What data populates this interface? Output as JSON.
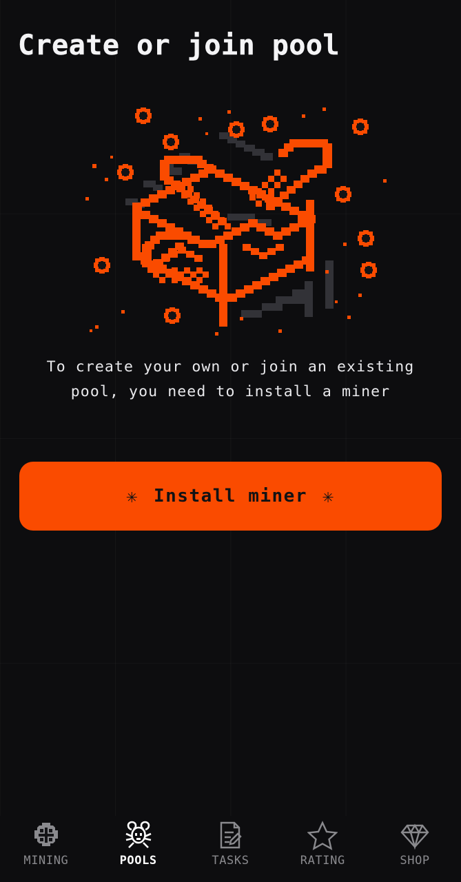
{
  "theme": {
    "background": "#0d0d0f",
    "accent": "#fa4b00",
    "text_primary": "#f4f4f6",
    "text_muted": "#8a8a8e",
    "button_text": "#121214"
  },
  "header": {
    "title": "Create or join pool"
  },
  "hero": {
    "icon_name": "pixel-cube-with-pickaxes-illustration",
    "cube_color": "#fa4b00",
    "shadow_color": "#3a3a3e",
    "sparkle_color": "#fa4b00"
  },
  "main": {
    "description": "To create your own or join an existing pool, you need to install a miner",
    "install_button": {
      "label": "Install miner",
      "left_icon": "asterisk-icon",
      "right_icon": "asterisk-icon",
      "glyph": "✳"
    }
  },
  "bottom_nav": {
    "active_index": 1,
    "items": [
      {
        "label": "MINING",
        "icon": "gear-asterisk-icon",
        "active": false
      },
      {
        "label": "POOLS",
        "icon": "mouse-head-icon",
        "active": true
      },
      {
        "label": "TASKS",
        "icon": "document-pencil-icon",
        "active": false
      },
      {
        "label": "RATING",
        "icon": "star-outline-icon",
        "active": false
      },
      {
        "label": "SHOP",
        "icon": "diamond-gem-icon",
        "active": false
      }
    ]
  }
}
